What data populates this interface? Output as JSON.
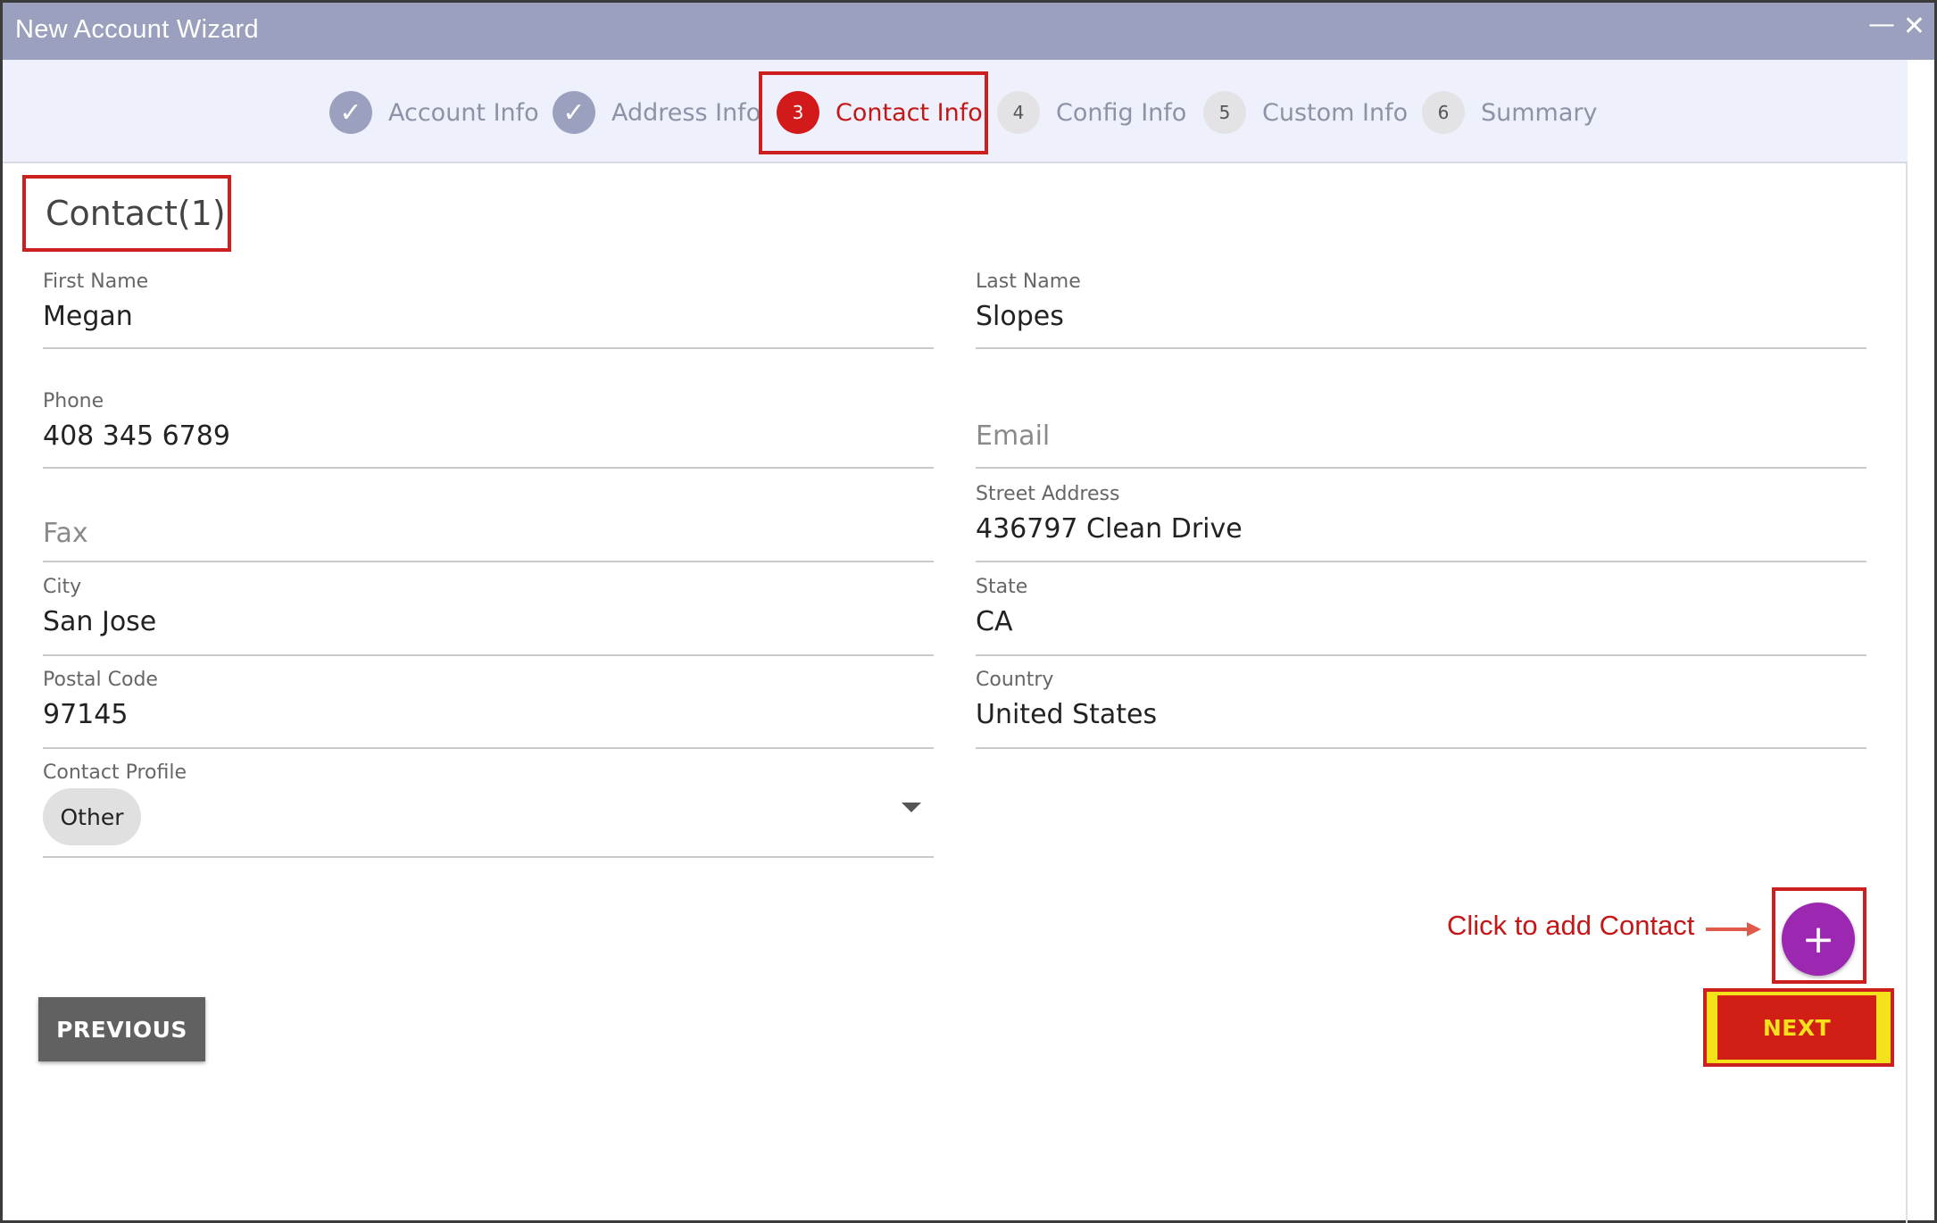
{
  "window": {
    "title": "New Account Wizard",
    "minimize_glyph": "—",
    "close_glyph": "✕"
  },
  "stepper": {
    "steps": [
      {
        "label": "Account Info",
        "number": "✓",
        "state": "done"
      },
      {
        "label": "Address Info",
        "number": "✓",
        "state": "done"
      },
      {
        "label": "Contact Info",
        "number": "3",
        "state": "active"
      },
      {
        "label": "Config Info",
        "number": "4",
        "state": "todo"
      },
      {
        "label": "Custom Info",
        "number": "5",
        "state": "todo"
      },
      {
        "label": "Summary",
        "number": "6",
        "state": "todo"
      }
    ]
  },
  "section": {
    "title": "Contact(1)"
  },
  "form": {
    "first_name": {
      "label": "First Name",
      "value": "Megan"
    },
    "last_name": {
      "label": "Last Name",
      "value": "Slopes"
    },
    "phone": {
      "label": "Phone",
      "value": "408 345 6789"
    },
    "email": {
      "placeholder": "Email"
    },
    "fax": {
      "placeholder": "Fax"
    },
    "street_address": {
      "label": "Street Address",
      "value": "436797 Clean Drive"
    },
    "city": {
      "label": "City",
      "value": "San Jose"
    },
    "state": {
      "label": "State",
      "value": "CA"
    },
    "postal_code": {
      "label": "Postal Code",
      "value": "97145"
    },
    "country": {
      "label": "Country",
      "value": "United States"
    },
    "contact_profile": {
      "label": "Contact Profile",
      "value": "Other"
    }
  },
  "annotation": {
    "text": "Click to add Contact"
  },
  "buttons": {
    "add_contact": "+",
    "previous": "PREVIOUS",
    "next": "NEXT"
  },
  "colors": {
    "titlebar": "#9aa0bd",
    "stepper_bg": "#eef0fb",
    "active_step": "#d31a1a",
    "highlight_border": "#cc1f1f",
    "add_button": "#9c27b0",
    "next_button": "#d11f16",
    "next_text": "#f5e21b",
    "previous_button": "#616161"
  }
}
